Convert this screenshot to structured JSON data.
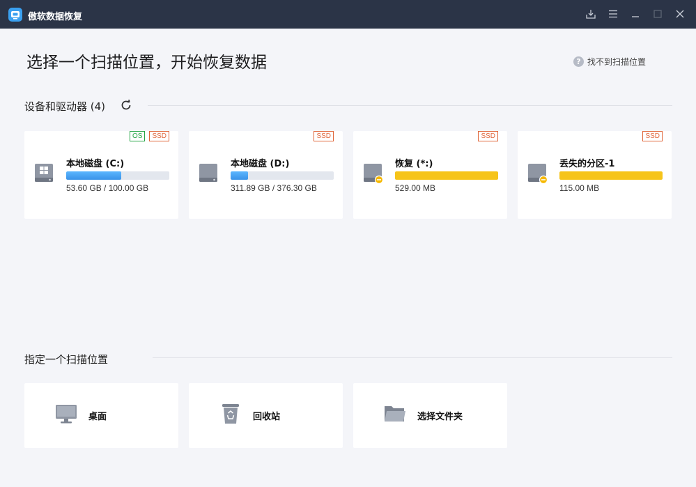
{
  "app": {
    "title": "傲软数据恢复"
  },
  "page": {
    "title": "选择一个扫描位置，开始恢复数据",
    "help_link": "找不到扫描位置"
  },
  "devices": {
    "section_title": "设备和驱动器 (4)",
    "drives": [
      {
        "name": "本地磁盘 (C:)",
        "size": "53.60 GB / 100.00 GB",
        "used_fraction": 0.536,
        "badges": [
          "OS",
          "SSD"
        ],
        "icon": "windows-drive-icon",
        "bar_color": "#3a93e8"
      },
      {
        "name": "本地磁盘 (D:)",
        "size": "311.89 GB / 376.30 GB",
        "used_fraction": 0.17,
        "badges": [
          "SSD"
        ],
        "icon": "hard-drive-icon",
        "bar_color": "#3a93e8"
      },
      {
        "name": "恢复 (*:)",
        "size": "529.00 MB",
        "used_fraction": 1.0,
        "badges": [
          "SSD"
        ],
        "icon": "drive-warning-icon",
        "bar_color": "#f6c41a"
      },
      {
        "name": "丢失的分区-1",
        "size": "115.00 MB",
        "used_fraction": 1.0,
        "badges": [
          "SSD"
        ],
        "icon": "drive-warning-icon",
        "bar_color": "#f6c41a"
      }
    ]
  },
  "locations": {
    "section_title": "指定一个扫描位置",
    "items": [
      {
        "label": "桌面",
        "icon": "desktop-icon"
      },
      {
        "label": "回收站",
        "icon": "recycle-bin-icon"
      },
      {
        "label": "选择文件夹",
        "icon": "folder-icon"
      }
    ]
  },
  "colors": {
    "titlebar": "#2b3447",
    "background": "#f4f5f9",
    "accent": "#3a93e8",
    "warning": "#f6c41a",
    "os_badge": "#27a647",
    "ssd_badge": "#e0663a"
  }
}
